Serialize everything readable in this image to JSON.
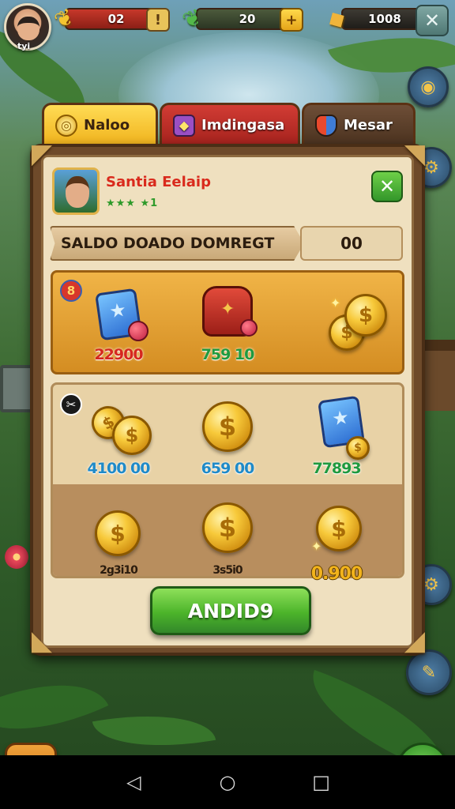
{
  "hud": {
    "avatar_name": "tyi",
    "resource_1": "02",
    "resource_2": "20",
    "resource_3": "1008",
    "info_label": "!",
    "plus_label": "+",
    "close_label": "✕"
  },
  "tabs": [
    {
      "label": "Naloo",
      "icon": "coin-icon"
    },
    {
      "label": "Imdingasa",
      "icon": "crystal-icon"
    },
    {
      "label": "Mesar",
      "icon": "shield-icon"
    }
  ],
  "profile": {
    "name": "Santia Eelaip",
    "rating": "★★★ ★1",
    "close_label": "✕"
  },
  "balance": {
    "label": "SALDO DOADO DOMREGT",
    "value": "00"
  },
  "featured": {
    "badge": "8",
    "items": [
      {
        "icon": "blue-chest-icon",
        "price": "22900"
      },
      {
        "icon": "red-bag-icon",
        "price": "759 10"
      },
      {
        "icon": "coin-stack-icon",
        "price": ""
      }
    ]
  },
  "shop": {
    "badge": "✂",
    "items": [
      {
        "icon": "coins-icon",
        "price": "4100 00"
      },
      {
        "icon": "coin-icon",
        "price": "659 00"
      },
      {
        "icon": "blue-chest-icon",
        "price": "77893"
      },
      {
        "icon": "coin-icon",
        "price": "2g3i10"
      },
      {
        "icon": "coin-icon",
        "price": "3s5i0"
      },
      {
        "icon": "coin-stack-icon",
        "price": "0.900"
      }
    ]
  },
  "buy_button": "ANDID9",
  "colors": {
    "accent_green": "#4cb42a",
    "accent_gold": "#f0b21c",
    "accent_red": "#d6281e",
    "panel_bg": "#efe0bf"
  }
}
